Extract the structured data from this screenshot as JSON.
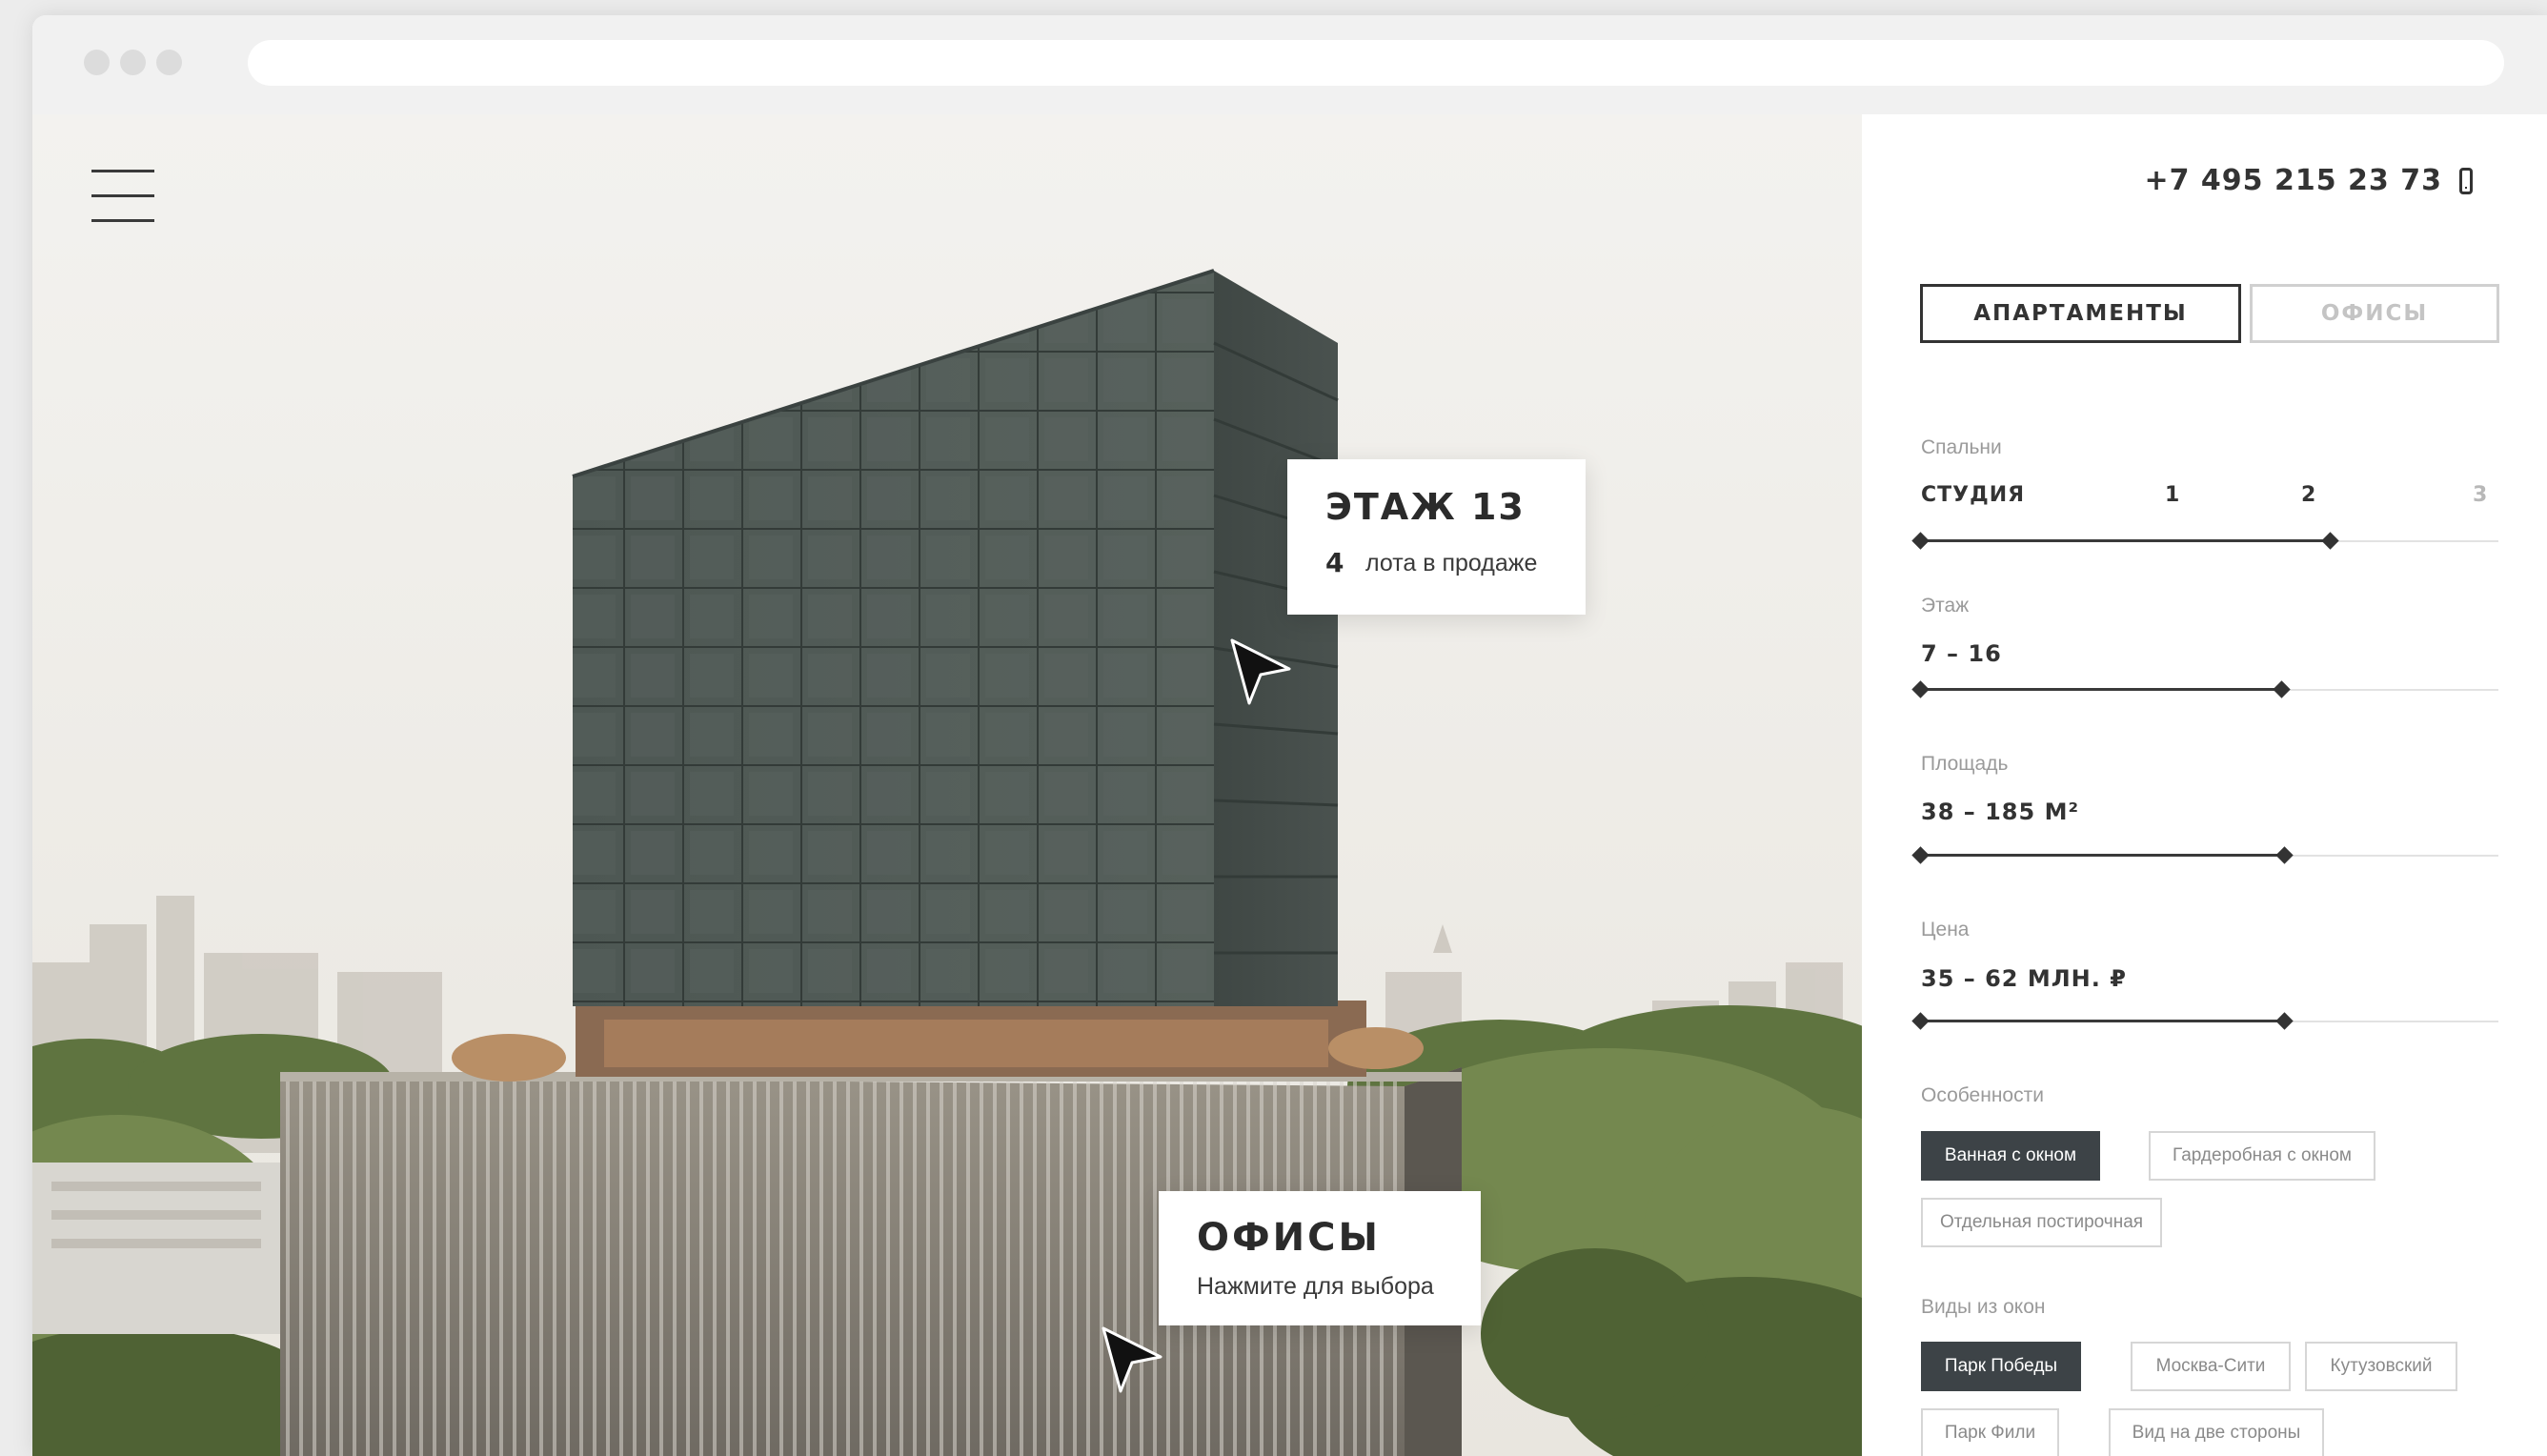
{
  "overlay": {
    "floor_card": {
      "title": "ЭТАЖ 13",
      "count": "4",
      "subtitle": "лота в продаже"
    },
    "office_card": {
      "title": "ОФИСЫ",
      "subtitle": "Нажмите для выбора"
    }
  },
  "panel": {
    "phone": "+7  495  215 23 73",
    "tabs": [
      {
        "label": "АПАРТАМЕНТЫ",
        "active": true
      },
      {
        "label": "ОФИСЫ",
        "active": false
      }
    ],
    "bedrooms": {
      "label": "Спальни",
      "options": [
        {
          "label": "СТУДИЯ",
          "selected": true
        },
        {
          "label": "1",
          "selected": true
        },
        {
          "label": "2",
          "selected": true
        },
        {
          "label": "3",
          "selected": false
        }
      ],
      "range_fraction": [
        0,
        0.71
      ]
    },
    "floor": {
      "label": "Этаж",
      "value": "7 – 16",
      "range_fraction": [
        0,
        0.625
      ]
    },
    "area": {
      "label": "Площадь",
      "value": "38 – 185 М²",
      "range_fraction": [
        0,
        0.63
      ]
    },
    "price": {
      "label": "Цена",
      "value": "35 – 62 МЛН. ₽",
      "range_fraction": [
        0,
        0.63
      ]
    },
    "features": {
      "label": "Особенности",
      "chips": [
        {
          "label": "Ванная с окном",
          "active": true
        },
        {
          "label": "Гардеробная с окном",
          "active": false
        },
        {
          "label": "Отдельная постирочная",
          "active": false
        }
      ]
    },
    "views": {
      "label": "Виды из окон",
      "chips": [
        {
          "label": "Парк Победы",
          "active": true
        },
        {
          "label": "Москва-Сити",
          "active": false
        },
        {
          "label": "Кутузовский",
          "active": false
        },
        {
          "label": "Парк Фили",
          "active": false
        },
        {
          "label": "Вид на две стороны",
          "active": false
        }
      ]
    }
  },
  "colors": {
    "accent_dark": "#3d4347",
    "panel_bg": "#ffffff",
    "tower_glass": "#4b5551"
  },
  "icons": [
    "menu-icon",
    "phone-icon",
    "cursor-arrow-icon"
  ]
}
